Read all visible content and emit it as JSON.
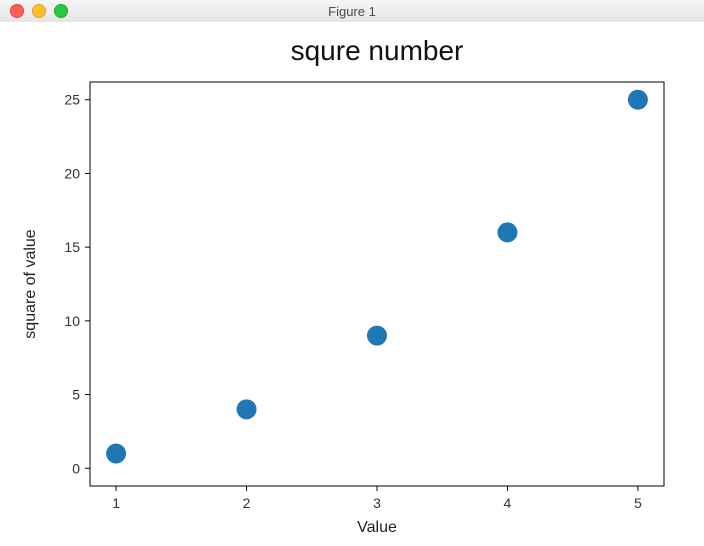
{
  "window": {
    "title": "Figure 1"
  },
  "chart_data": {
    "type": "scatter",
    "title": "squre number",
    "xlabel": "Value",
    "ylabel": "square of value",
    "x": [
      1,
      2,
      3,
      4,
      5
    ],
    "y": [
      1,
      4,
      9,
      16,
      25
    ],
    "xticks": [
      1,
      2,
      3,
      4,
      5
    ],
    "yticks": [
      0,
      5,
      10,
      15,
      20,
      25
    ],
    "xlim": [
      0.8,
      5.2
    ],
    "ylim": [
      -1.2,
      26.2
    ],
    "point_color": "#1f77b4",
    "point_radius": 10
  }
}
